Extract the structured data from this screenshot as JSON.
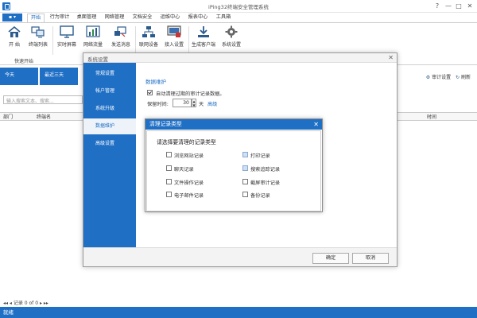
{
  "window": {
    "title": "iPing32终端安全管理系统",
    "controls": [
      "?",
      "—",
      "□",
      "✕"
    ]
  },
  "ribbon": {
    "menu_label": "▪ ▾",
    "tabs": [
      "开始",
      "行为审计",
      "桌面管理",
      "网络管理",
      "文档安全",
      "运维中心",
      "报表中心",
      "工具箱"
    ],
    "active_tab": "开始",
    "buttons": [
      {
        "label": "开 始",
        "icon": "home-icon"
      },
      {
        "label": "终端列表",
        "icon": "terminal-list-icon"
      },
      {
        "label": "实时屏幕",
        "icon": "monitor-icon"
      },
      {
        "label": "网络流量",
        "icon": "traffic-chart-icon"
      },
      {
        "label": "发送消息",
        "icon": "send-message-icon"
      },
      {
        "label": "联网设备",
        "icon": "network-device-icon"
      },
      {
        "label": "接入设置",
        "icon": "access-settings-icon"
      },
      {
        "label": "生成客户端",
        "icon": "download-icon"
      },
      {
        "label": "系统设置",
        "icon": "gear-icon"
      }
    ],
    "group_label": "快速开始"
  },
  "main": {
    "days": [
      "今天",
      "最近三天"
    ],
    "audit_settings": "审计设置",
    "refresh": "刷新",
    "search_placeholder": "输入搜索文本、搜索...",
    "columns": [
      "部门",
      "终端名",
      "时间"
    ],
    "pager": "记录 0 of 0"
  },
  "statusbar": {
    "text": "就绪"
  },
  "settings_dialog": {
    "title": "系统设置",
    "nav": [
      "常规设置",
      "帐户管理",
      "系统升级",
      "数据维护",
      "高级设置"
    ],
    "active_nav": "数据维护",
    "section_title": "数据维护",
    "auto_clean_label": "自动清理过期的审计记录数据。",
    "auto_clean_checked": true,
    "retain_label": "保留时间:",
    "retain_value": "30",
    "retain_unit": "天",
    "advanced_link": "高级",
    "ok": "确定",
    "cancel": "取消"
  },
  "clean_dialog": {
    "title": "清理记录类型",
    "heading": "请选择要清理的记录类型",
    "options_left": [
      "浏览网站记录",
      "聊天记录",
      "文件操作记录",
      "电子邮件记录"
    ],
    "options_right": [
      "打印记录",
      "搜索追踪记录",
      "截屏审计记录",
      "备份记录"
    ]
  }
}
